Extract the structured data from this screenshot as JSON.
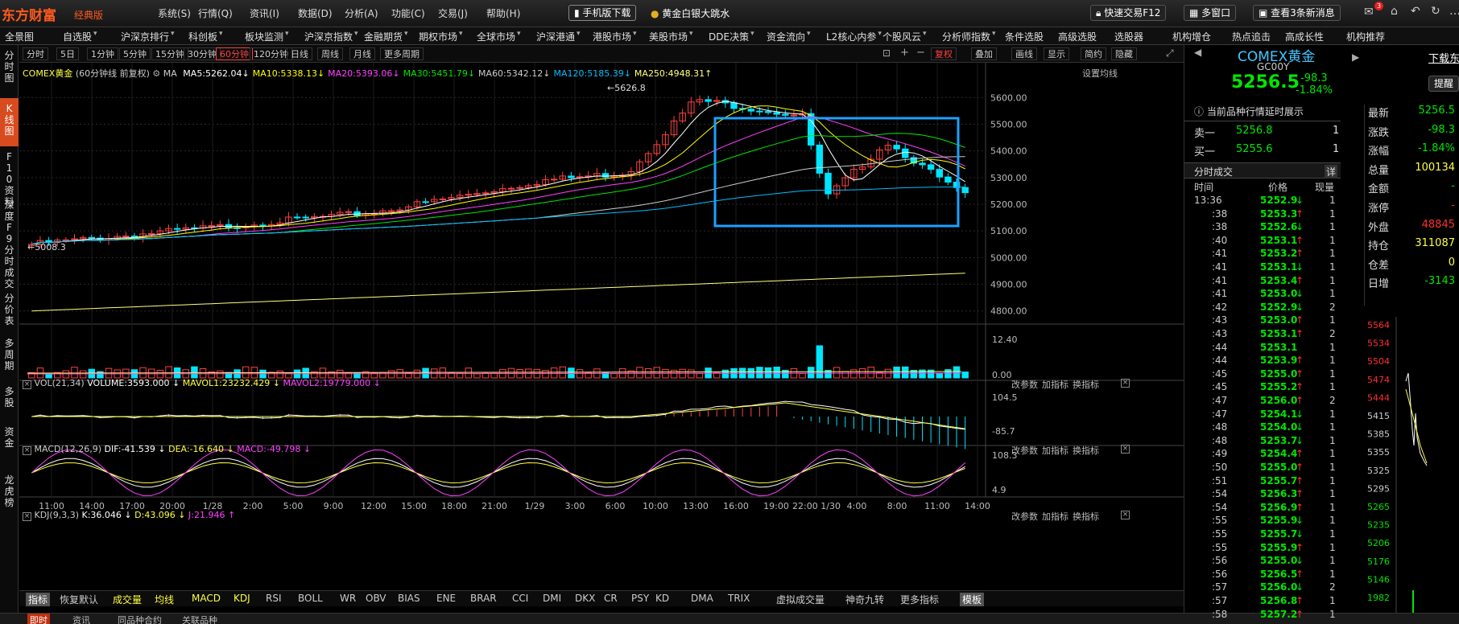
{
  "app": {
    "logo": "东方财富",
    "edition": "经典版"
  },
  "menu": [
    "系统(S)",
    "行情(Q)",
    "资讯(I)",
    "数据(D)",
    "分析(A)",
    "功能(C)",
    "交易(J)",
    "帮助(H)"
  ],
  "promo": {
    "mobile_download": "手机版下载",
    "headline": "黄金白银大跳水"
  },
  "top_right": {
    "quick_trade": "快速交易F12",
    "multi_window": "多窗口",
    "news": "查看3条新消息",
    "badge": "3"
  },
  "nav": [
    "全景图",
    "自选股",
    "沪深京排行",
    "科创板",
    "板块监测",
    "沪深京指数",
    "金融期货",
    "期权市场",
    "全球市场",
    "沪深港通",
    "港股市场",
    "美股市场",
    "DDE决策",
    "资金流向",
    "L2核心内参",
    "个股风云",
    "分析师指数",
    "条件选股",
    "高级选股",
    "选股器",
    "机构增仓",
    "热点追击",
    "高成长性",
    "机构推荐"
  ],
  "periods": [
    "分时",
    "5日",
    "1分钟",
    "5分钟",
    "15分钟",
    "30分钟",
    "60分钟",
    "120分钟",
    "日线",
    "周线",
    "月线",
    "更多周期"
  ],
  "active_period": "60分钟",
  "tools": {
    "fuquan": "复权",
    "overlay": "叠加",
    "draw": "画线",
    "display": "显示",
    "simple": "简约",
    "hide": "隐藏"
  },
  "left_tabs": [
    "分时图",
    "K线图",
    "F10资料",
    "深度F9",
    "分时成交",
    "分价表",
    "多周期",
    "多股",
    "资金",
    "龙虎榜"
  ],
  "main_chart": {
    "symbol": "COMEX黄金",
    "period_label": "(60分钟线 前复权)",
    "ma_prefix": "MA",
    "ma": [
      {
        "label": "MA5:5262.04",
        "color": "#ffffff"
      },
      {
        "label": "MA10:5338.13",
        "color": "#ffff00"
      },
      {
        "label": "MA20:5393.06",
        "color": "#ff40ff"
      },
      {
        "label": "MA30:5451.79",
        "color": "#00e600"
      },
      {
        "label": "MA60:5342.12",
        "color": "#cccccc"
      },
      {
        "label": "MA120:5185.39",
        "color": "#00bfff"
      },
      {
        "label": "MA250:4948.31",
        "color": "#ffff80"
      }
    ],
    "settings": "设置均线",
    "high_note": "5626.8",
    "low_note": "5008.3",
    "y_ticks": [
      "5600.00",
      "5500.00",
      "5400.00",
      "5300.00",
      "5200.00",
      "5100.00",
      "5000.00",
      "4900.00",
      "4800.00"
    ]
  },
  "vol_panel": {
    "title": "VOL(21,34)",
    "value": "VOLUME:3593.000",
    "mavol1": "MAVOL1:23232.429",
    "mavol2": "MAVOL2:19779.000",
    "ticks": [
      "12.40",
      "0.00"
    ]
  },
  "macd_panel": {
    "title": "MACD(12,26,9)",
    "dif": "DIF:-41.539",
    "dea": "DEA:-16.640",
    "macd": "MACD:-49.798",
    "ticks": [
      "104.5",
      "-85.7"
    ]
  },
  "kdj_panel": {
    "title": "KDJ(9,3,3)",
    "k": "K:36.046",
    "d": "D:43.096",
    "j": "J:21.946",
    "ticks": [
      "108.3",
      "4.9"
    ]
  },
  "panel_buttons": [
    "改参数",
    "加指标",
    "换指标"
  ],
  "x_labels": [
    "11:00",
    "14:00",
    "17:00",
    "20:00",
    "1/28",
    "2:00",
    "5:00",
    "9:00",
    "12:00",
    "15:00",
    "18:00",
    "21:00",
    "1/29",
    "3:00",
    "6:00",
    "10:00",
    "13:00",
    "16:00",
    "19:00",
    "22:00 1/30",
    "4:00",
    "8:00",
    "11:00",
    "14:00"
  ],
  "bottom_tabs": [
    "指标",
    "恢复默认",
    "成交量",
    "均线",
    "MACD",
    "KDJ",
    "RSI",
    "BOLL",
    "WR",
    "OBV",
    "BIAS",
    "ENE",
    "BRAR",
    "CCI",
    "DMI",
    "DKX",
    "CR",
    "PSY",
    "KD",
    "DMA",
    "TRIX",
    "虚拟成交量",
    "神奇九转",
    "更多指标",
    "模板"
  ],
  "status_tabs": [
    "即时",
    "资讯",
    "同品种合约",
    "关联品种"
  ],
  "quote": {
    "name": "COMEX黄金",
    "code": "GC00Y",
    "price": "5256.5",
    "change": "-98.3",
    "change_pct": "-1.84%",
    "delay_note": "当前品种行情延时展示",
    "ask_label": "卖一",
    "ask": "5256.8",
    "ask_vol": "1",
    "bid_label": "买一",
    "bid": "5255.6",
    "bid_vol": "1",
    "ticks_title": "分时成交",
    "detail": "详",
    "col_time": "时间",
    "col_price": "价格",
    "col_vol": "现量"
  },
  "ticks": [
    {
      "t": "13:36",
      "p": "5252.9",
      "d": "down",
      "v": "1"
    },
    {
      "t": ":38",
      "p": "5253.3",
      "d": "up",
      "v": "1"
    },
    {
      "t": ":38",
      "p": "5252.6",
      "d": "down",
      "v": "1"
    },
    {
      "t": ":40",
      "p": "5253.1",
      "d": "up",
      "v": "1"
    },
    {
      "t": ":41",
      "p": "5253.2",
      "d": "up",
      "v": "1"
    },
    {
      "t": ":41",
      "p": "5253.1",
      "d": "down",
      "v": "1"
    },
    {
      "t": ":41",
      "p": "5253.4",
      "d": "up",
      "v": "1"
    },
    {
      "t": ":41",
      "p": "5253.0",
      "d": "down",
      "v": "1"
    },
    {
      "t": ":42",
      "p": "5252.9",
      "d": "down",
      "v": "2"
    },
    {
      "t": ":43",
      "p": "5253.0",
      "d": "up",
      "v": "1"
    },
    {
      "t": ":43",
      "p": "5253.1",
      "d": "up",
      "v": "2"
    },
    {
      "t": ":44",
      "p": "5253.1",
      "d": "",
      "v": "1"
    },
    {
      "t": ":44",
      "p": "5253.9",
      "d": "up",
      "v": "1"
    },
    {
      "t": ":45",
      "p": "5255.0",
      "d": "up",
      "v": "1"
    },
    {
      "t": ":45",
      "p": "5255.2",
      "d": "up",
      "v": "1"
    },
    {
      "t": ":47",
      "p": "5256.0",
      "d": "up",
      "v": "2"
    },
    {
      "t": ":47",
      "p": "5254.1",
      "d": "down",
      "v": "1"
    },
    {
      "t": ":48",
      "p": "5254.0",
      "d": "down",
      "v": "1"
    },
    {
      "t": ":48",
      "p": "5253.7",
      "d": "down",
      "v": "1"
    },
    {
      "t": ":49",
      "p": "5254.4",
      "d": "up",
      "v": "1"
    },
    {
      "t": ":50",
      "p": "5255.0",
      "d": "up",
      "v": "1"
    },
    {
      "t": ":51",
      "p": "5255.7",
      "d": "up",
      "v": "1"
    },
    {
      "t": ":54",
      "p": "5256.3",
      "d": "up",
      "v": "1"
    },
    {
      "t": ":54",
      "p": "5256.9",
      "d": "up",
      "v": "1"
    },
    {
      "t": ":55",
      "p": "5255.9",
      "d": "down",
      "v": "1"
    },
    {
      "t": ":55",
      "p": "5255.7",
      "d": "down",
      "v": "1"
    },
    {
      "t": ":55",
      "p": "5255.9",
      "d": "up",
      "v": "1"
    },
    {
      "t": ":56",
      "p": "5255.0",
      "d": "down",
      "v": "1"
    },
    {
      "t": ":56",
      "p": "5256.5",
      "d": "up",
      "v": "1"
    },
    {
      "t": ":57",
      "p": "5256.0",
      "d": "down",
      "v": "2"
    },
    {
      "t": ":57",
      "p": "5256.8",
      "d": "up",
      "v": "1"
    },
    {
      "t": ":58",
      "p": "5257.2",
      "d": "up",
      "v": "1"
    }
  ],
  "stats": [
    {
      "k": "最新",
      "v": "5256.5",
      "c": "grn"
    },
    {
      "k": "涨跌",
      "v": "-98.3",
      "c": "grn"
    },
    {
      "k": "涨幅",
      "v": "-1.84%",
      "c": "grn"
    },
    {
      "k": "总量",
      "v": "100134",
      "c": "yel"
    },
    {
      "k": "金额",
      "v": "-",
      "c": "grn"
    },
    {
      "k": "涨停",
      "v": "-",
      "c": "red"
    },
    {
      "k": "外盘",
      "v": "48845",
      "c": "red"
    },
    {
      "k": "持仓",
      "v": "311087",
      "c": "yel"
    },
    {
      "k": "仓差",
      "v": "0",
      "c": "yel"
    },
    {
      "k": "日增",
      "v": "-3143",
      "c": "grn"
    }
  ],
  "far_right": {
    "download": "下载东",
    "reminder": "提醒",
    "price_levels": [
      "5564",
      "5534",
      "5504",
      "5474",
      "5444",
      "5415",
      "5385",
      "5355",
      "5325",
      "5295",
      "5265",
      "5235",
      "5206",
      "5176",
      "5146",
      "1982"
    ]
  }
}
